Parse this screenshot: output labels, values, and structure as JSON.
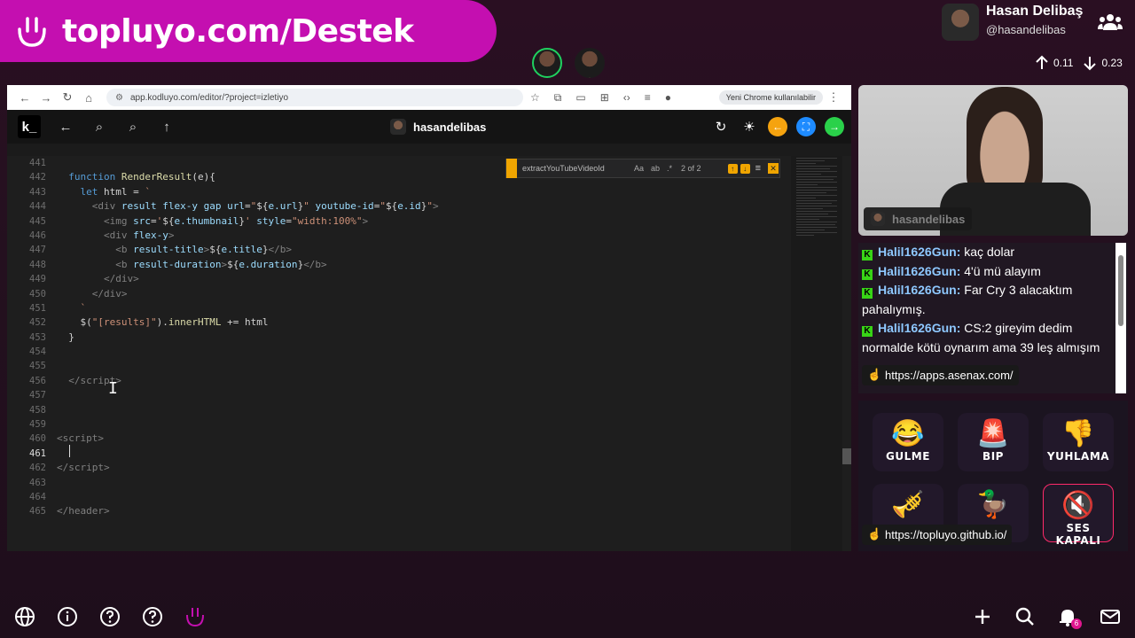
{
  "banner": {
    "text": "topluyo.com/Destek"
  },
  "profile": {
    "name": "Hasan Delibaş",
    "handle": "@hasandelibas"
  },
  "network": {
    "up": "0.11",
    "down": "0.23"
  },
  "browser": {
    "url": "app.kodluyo.com/editor/?project=izletiyo",
    "chrome_notice": "Yeni Chrome kullanılabilir"
  },
  "editor": {
    "logo": "k_",
    "user": "hasandelibas",
    "find_query": "extractYouTubeVideoId",
    "find_opt_case": "Aa",
    "find_opt_word": "ab",
    "find_opt_regex": ".*",
    "find_count": "2 of 2",
    "line_numbers": [
      "441",
      "442",
      "443",
      "444",
      "445",
      "446",
      "447",
      "448",
      "449",
      "450",
      "451",
      "452",
      "453",
      "454",
      "455",
      "456",
      "457",
      "458",
      "459",
      "460",
      "461",
      "462",
      "463",
      "464",
      "465"
    ],
    "active_line": "461",
    "bottom_user": "hasandelibas"
  },
  "webcam": {
    "name": "hasandelibas"
  },
  "chat": {
    "badge": "K",
    "messages": [
      {
        "user": "Halil1626Gun:",
        "text": "kaç dolar"
      },
      {
        "user": "Halil1626Gun:",
        "text": "4'ü mü alayım"
      },
      {
        "user": "Halil1626Gun:",
        "text": "Far Cry 3 alacaktım pahalıymış."
      },
      {
        "user": "Halil1626Gun:",
        "text": "CS:2 gireyim dedim normalde kötü oynarım ama 39 leş almışım"
      }
    ],
    "link": "https://apps.asenax.com/"
  },
  "reactions": {
    "items": [
      {
        "emoji": "😂",
        "label": "GULME"
      },
      {
        "emoji": "🚨",
        "label": "BIP"
      },
      {
        "emoji": "👎",
        "label": "YUHLAMA"
      },
      {
        "emoji": "🎺",
        "label": ""
      },
      {
        "emoji": "🦆",
        "label": ""
      },
      {
        "emoji": "🔇",
        "label": "SES KAPALI"
      }
    ],
    "link": "https://topluyo.github.io/"
  },
  "notifications": {
    "count": "6"
  },
  "colors": {
    "brand": "#c40fb0",
    "accent_orange": "#f0a500",
    "accent_green": "#1fd15f",
    "chat_user": "#8ec8ff"
  }
}
